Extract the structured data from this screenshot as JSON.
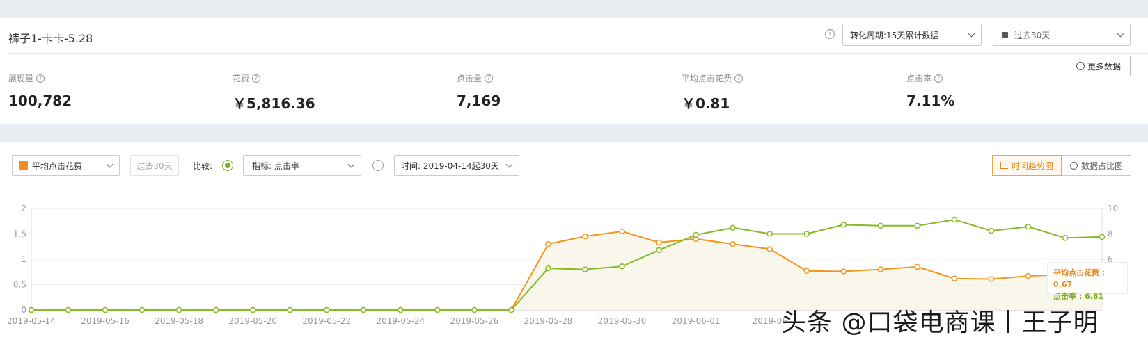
{
  "header": {
    "title": "裤子1-卡卡-5.28",
    "conversion_select": "转化周期:15天累计数据",
    "date_select": "过去30天",
    "more_data": "更多数据"
  },
  "metrics": [
    {
      "label": "展现量",
      "value": "100,782"
    },
    {
      "label": "花费",
      "value": "￥5,816.36"
    },
    {
      "label": "点击量",
      "value": "7,169"
    },
    {
      "label": "平均点击花费",
      "value": "￥0.81"
    },
    {
      "label": "点击率",
      "value": "7.11%"
    }
  ],
  "toolbar": {
    "metric_select": "平均点击花费",
    "period_button": "过去30天",
    "compare_label": "比较:",
    "indicator_select": "指标:  点击率",
    "time_select": "时间:  2019-04-14起30天",
    "view_trend": "时间趋势图",
    "view_share": "数据占比图"
  },
  "tooltip": {
    "line1": "平均点击花费 : 0.67",
    "line2": "点击率 : 6.81"
  },
  "watermark": "头条 @口袋电商课丨王子明",
  "colors": {
    "orange": "#f0961f",
    "green": "#86b927"
  },
  "chart_data": {
    "type": "line",
    "x": [
      "2019-05-14",
      "2019-05-15",
      "2019-05-16",
      "2019-05-17",
      "2019-05-18",
      "2019-05-19",
      "2019-05-20",
      "2019-05-21",
      "2019-05-22",
      "2019-05-23",
      "2019-05-24",
      "2019-05-25",
      "2019-05-26",
      "2019-05-27",
      "2019-05-28",
      "2019-05-29",
      "2019-05-30",
      "2019-05-31",
      "2019-06-01",
      "2019-06-02",
      "2019-06-03",
      "2019-06-04",
      "2019-06-05",
      "2019-06-06",
      "2019-06-07",
      "2019-06-08",
      "2019-06-09",
      "2019-06-10",
      "2019-06-11",
      "2019-06-12"
    ],
    "x_tick_labels": [
      "2019-05-14",
      "2019-05-16",
      "2019-05-18",
      "2019-05-20",
      "2019-05-22",
      "2019-05-24",
      "2019-05-26",
      "2019-05-28",
      "2019-05-30",
      "2019-06-01",
      "2019-06",
      "",
      "",
      "",
      ""
    ],
    "series": [
      {
        "name": "平均点击花费",
        "axis": "left",
        "color": "#f0961f",
        "values": [
          0,
          0,
          0,
          0,
          0,
          0,
          0,
          0,
          0,
          0,
          0,
          0,
          0,
          0,
          1.3,
          1.45,
          1.55,
          1.33,
          1.4,
          1.3,
          1.2,
          0.77,
          0.76,
          0.8,
          0.85,
          0.62,
          0.61,
          0.67,
          0.7,
          0.7
        ]
      },
      {
        "name": "点击率",
        "axis": "right",
        "color": "#86b927",
        "values": [
          0,
          0,
          0,
          0,
          0,
          0,
          0,
          0,
          0,
          0,
          0,
          0,
          0,
          0,
          4.1,
          4.0,
          4.3,
          5.9,
          7.4,
          8.1,
          7.5,
          7.5,
          8.4,
          8.3,
          8.3,
          8.9,
          7.8,
          8.2,
          7.1,
          7.2
        ]
      }
    ],
    "ylim_left": [
      0,
      2
    ],
    "yticks_left": [
      "0",
      "0.5",
      "1",
      "1.5",
      "2"
    ],
    "ylim_right": [
      0,
      10
    ],
    "yticks_right": [
      "",
      "",
      "6",
      "8",
      "10"
    ],
    "grid": true
  }
}
